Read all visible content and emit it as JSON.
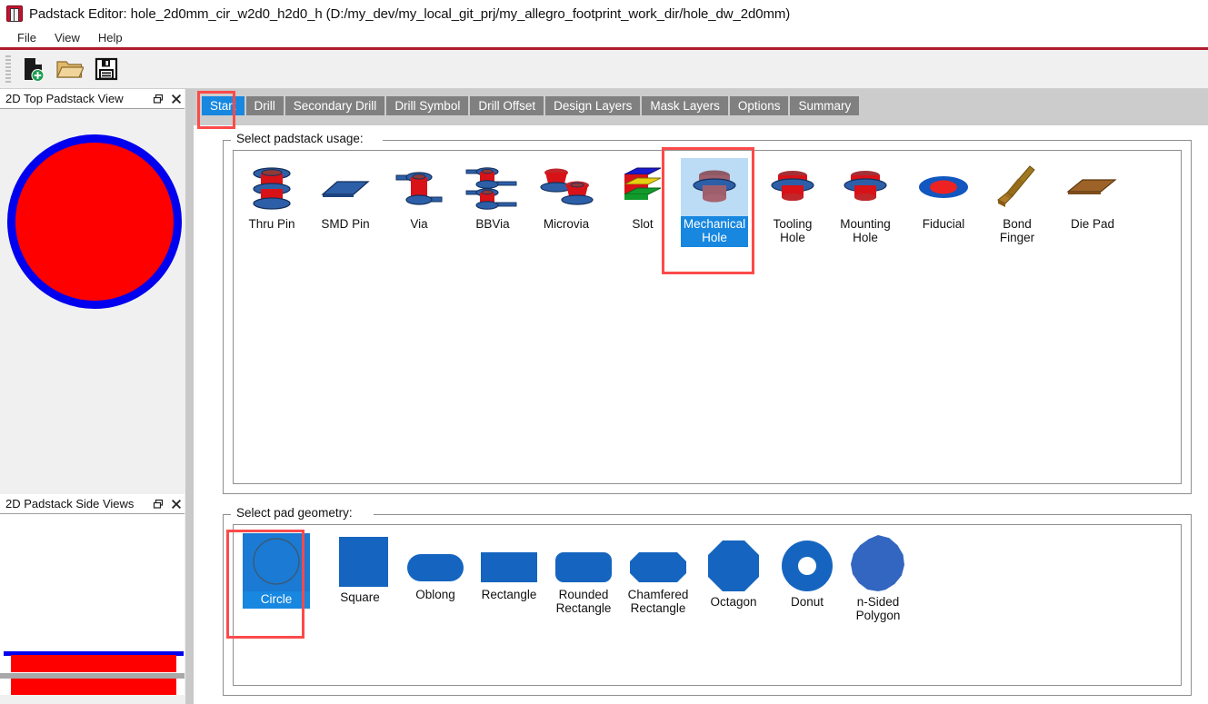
{
  "window": {
    "title": "Padstack Editor: hole_2d0mm_cir_w2d0_h2d0_h  (D:/my_dev/my_local_git_prj/my_allegro_footprint_work_dir/hole_dw_2d0mm)",
    "app_icon": "padstack-editor-icon"
  },
  "menubar": {
    "items": [
      "File",
      "View",
      "Help"
    ]
  },
  "toolbar": {
    "buttons": [
      {
        "name": "new-padstack-icon",
        "glyph": "new-file-plus"
      },
      {
        "name": "open-padstack-icon",
        "glyph": "open-folder"
      },
      {
        "name": "save-padstack-icon",
        "glyph": "floppy-save"
      }
    ]
  },
  "dock": {
    "top_view": {
      "title": "2D Top Padstack View",
      "float_icon": "restore-icon",
      "close_icon": "close-icon",
      "pad_fill_color": "#ff0000",
      "pad_ring_color": "#0000ee"
    },
    "side_views": {
      "title": "2D Padstack Side Views",
      "float_icon": "restore-icon",
      "close_icon": "close-icon",
      "mask_color": "#0000ee",
      "pad_color": "#ff0000",
      "drill_color": "#a8a8a8"
    }
  },
  "tabs": {
    "selected": "Start",
    "items": [
      "Start",
      "Drill",
      "Secondary Drill",
      "Drill Symbol",
      "Drill Offset",
      "Design Layers",
      "Mask Layers",
      "Options",
      "Summary"
    ],
    "selected_color": "#1787e0",
    "unselected_color": "#808080"
  },
  "padstack_usage": {
    "group_label": "Select padstack usage:",
    "selected": "Mechanical Hole",
    "items": [
      {
        "label": "Thru Pin",
        "icon": "thru-pin-icon"
      },
      {
        "label": "SMD Pin",
        "icon": "smd-pin-icon"
      },
      {
        "label": "Via",
        "icon": "via-icon"
      },
      {
        "label": "BBVia",
        "icon": "bbvia-icon"
      },
      {
        "label": "Microvia",
        "icon": "microvia-icon"
      },
      {
        "label": "Slot",
        "icon": "slot-icon"
      },
      {
        "label": "Mechanical\nHole",
        "icon": "mechanical-hole-icon"
      },
      {
        "label": "Tooling\nHole",
        "icon": "tooling-hole-icon"
      },
      {
        "label": "Mounting\nHole",
        "icon": "mounting-hole-icon"
      },
      {
        "label": "Fiducial",
        "icon": "fiducial-icon"
      },
      {
        "label": "Bond\nFinger",
        "icon": "bond-finger-icon"
      },
      {
        "label": "Die Pad",
        "icon": "die-pad-icon"
      }
    ]
  },
  "pad_geometry": {
    "group_label": "Select pad geometry:",
    "selected": "Circle",
    "items": [
      {
        "label": "Circle",
        "icon": "circle-shape-icon"
      },
      {
        "label": "Square",
        "icon": "square-shape-icon"
      },
      {
        "label": "Oblong",
        "icon": "oblong-shape-icon"
      },
      {
        "label": "Rectangle",
        "icon": "rectangle-shape-icon"
      },
      {
        "label": "Rounded\nRectangle",
        "icon": "rounded-rectangle-shape-icon"
      },
      {
        "label": "Chamfered\nRectangle",
        "icon": "chamfered-rectangle-shape-icon"
      },
      {
        "label": "Octagon",
        "icon": "octagon-shape-icon"
      },
      {
        "label": "Donut",
        "icon": "donut-shape-icon"
      },
      {
        "label": "n-Sided\nPolygon",
        "icon": "n-sided-polygon-shape-icon"
      }
    ],
    "shape_color": "#1565c0"
  },
  "annotations": {
    "highlight_color": "#fc4a4a",
    "boxes": [
      "start-tab",
      "mechanical-hole-cell",
      "circle-geometry-cell"
    ]
  }
}
